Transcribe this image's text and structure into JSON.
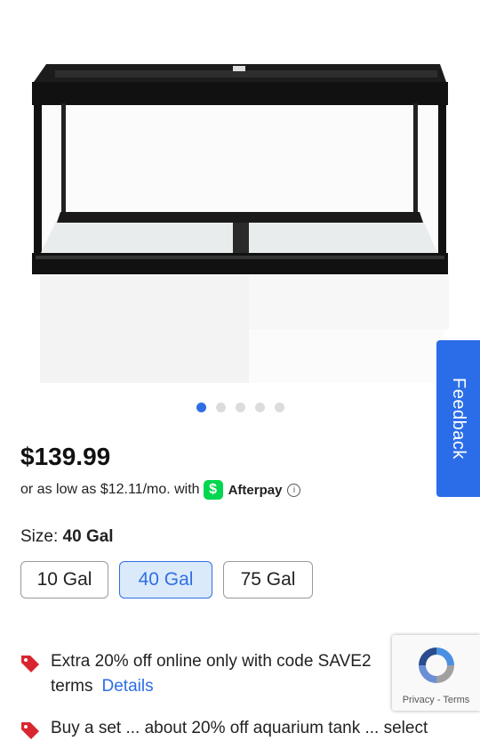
{
  "product": {
    "image_alt": "aquarium-tank",
    "carousel": {
      "count": 5,
      "active": 0
    },
    "price": "$139.99",
    "afterpay": {
      "prefix": "or as low as $12.11/mo. with",
      "cashapp_symbol": "$",
      "brand": "Afterpay",
      "info_symbol": "i"
    },
    "size": {
      "label": "Size:",
      "selected_value": "40 Gal",
      "options": [
        "10 Gal",
        "40 Gal",
        "75 Gal"
      ]
    }
  },
  "feedback": {
    "label": "Feedback"
  },
  "promos": [
    {
      "text": "Extra 20% off online only with code SAVE2",
      "line2": "terms",
      "link": "Details"
    },
    {
      "text": "Buy a set ... about 20% off aquarium tank ... select"
    }
  ],
  "recaptcha": {
    "privacy": "Privacy",
    "separator": "-",
    "terms": "Terms"
  },
  "colors": {
    "accent": "#2f6fe4",
    "feedback": "#2b6de8",
    "tag_red": "#d9262e",
    "cashapp_green": "#00d64f"
  }
}
